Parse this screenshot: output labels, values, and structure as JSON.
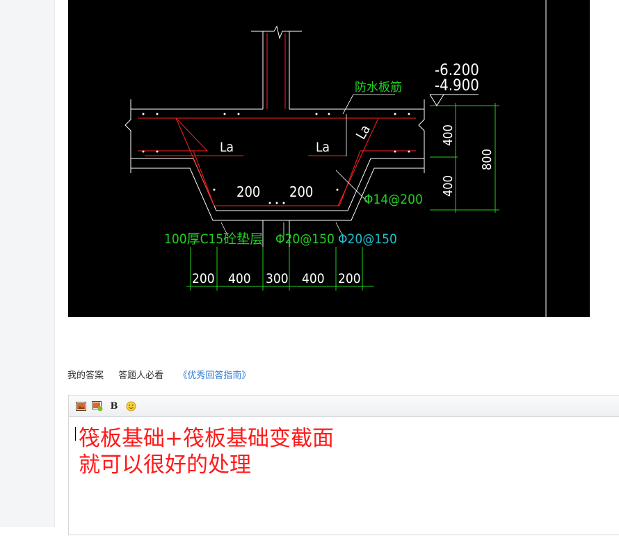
{
  "page": {
    "answer_bar": {
      "my_answer": "我的答案",
      "must_read": "答题人必看",
      "guide_link": "《优秀回答指南》"
    },
    "editor": {
      "toolbar": {
        "icons": [
          "image-icon",
          "insert-image-icon",
          "bold-icon",
          "emoji-icon"
        ],
        "bold_label": "B"
      },
      "content_lines": [
        "筏板基础+筏板基础变截面",
        "就可以很好的处理"
      ]
    }
  },
  "drawing": {
    "elevations": [
      "-6.200",
      "-4.900"
    ],
    "note_waterproof": "防水板筋",
    "la_left": "La",
    "la_center": "La",
    "la_diagonal": "La",
    "dim_200_left": "200",
    "dim_200_right": "200",
    "rebar_phi14": "Φ14@200",
    "cushion_label": "100厚C15砼垫层",
    "rebar_phi20_a": "Φ20@150",
    "rebar_phi20_b": "Φ20@150",
    "vertical_dims": [
      "400",
      "400",
      "800"
    ],
    "bottom_dims": [
      "200",
      "400",
      "300",
      "400",
      "200"
    ]
  },
  "colors": {
    "cad_background": "#000000",
    "cad_white": "#ffffff",
    "cad_red": "#ff2020",
    "cad_green": "#20d020",
    "cad_cyan": "#20c0d0",
    "answer_red": "#ff1a1a",
    "link_blue": "#2f7dd6"
  }
}
